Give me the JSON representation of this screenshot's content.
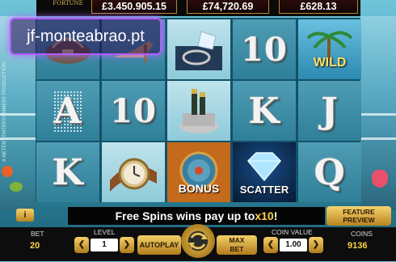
{
  "promo_text": "jf-monteabrao.pt",
  "logo": {
    "word": "FORTUNE"
  },
  "jackpots": [
    "£3.450.905.15",
    "£74,720.69",
    "£628.13"
  ],
  "side_text": "A NETENT ENTERTAINMENT PRODUCTION",
  "reels": [
    [
      {
        "symbol": "handbag"
      },
      {
        "symbol": "A"
      },
      {
        "symbol": "K"
      }
    ],
    [
      {
        "symbol": "shoe"
      },
      {
        "symbol": "10"
      },
      {
        "symbol": "watch"
      }
    ],
    [
      {
        "symbol": "ring"
      },
      {
        "symbol": "champagne"
      },
      {
        "symbol": "BONUS"
      }
    ],
    [
      {
        "symbol": "10"
      },
      {
        "symbol": "K"
      },
      {
        "symbol": "SCATTER"
      }
    ],
    [
      {
        "symbol": "WILD"
      },
      {
        "symbol": "J"
      },
      {
        "symbol": "Q"
      }
    ]
  ],
  "message": {
    "prefix": "Free Spins wins pay up to ",
    "highlight": "x10",
    "suffix": "!"
  },
  "buttons": {
    "info": "i",
    "feature_line1": "FEATURE",
    "feature_line2": "PREVIEW",
    "autoplay": "AUTOPLAY",
    "max_line1": "MAX",
    "max_line2": "BET"
  },
  "controls": {
    "bet_label": "BET",
    "bet_value": "20",
    "level_label": "LEVEL",
    "level_value": "1",
    "coin_value_label": "COIN VALUE",
    "coin_value": "1.00",
    "coins_label": "COINS",
    "coins_value": "9136"
  },
  "colors": {
    "highlight": "#ffd34a",
    "gold": "#d4a23a"
  }
}
